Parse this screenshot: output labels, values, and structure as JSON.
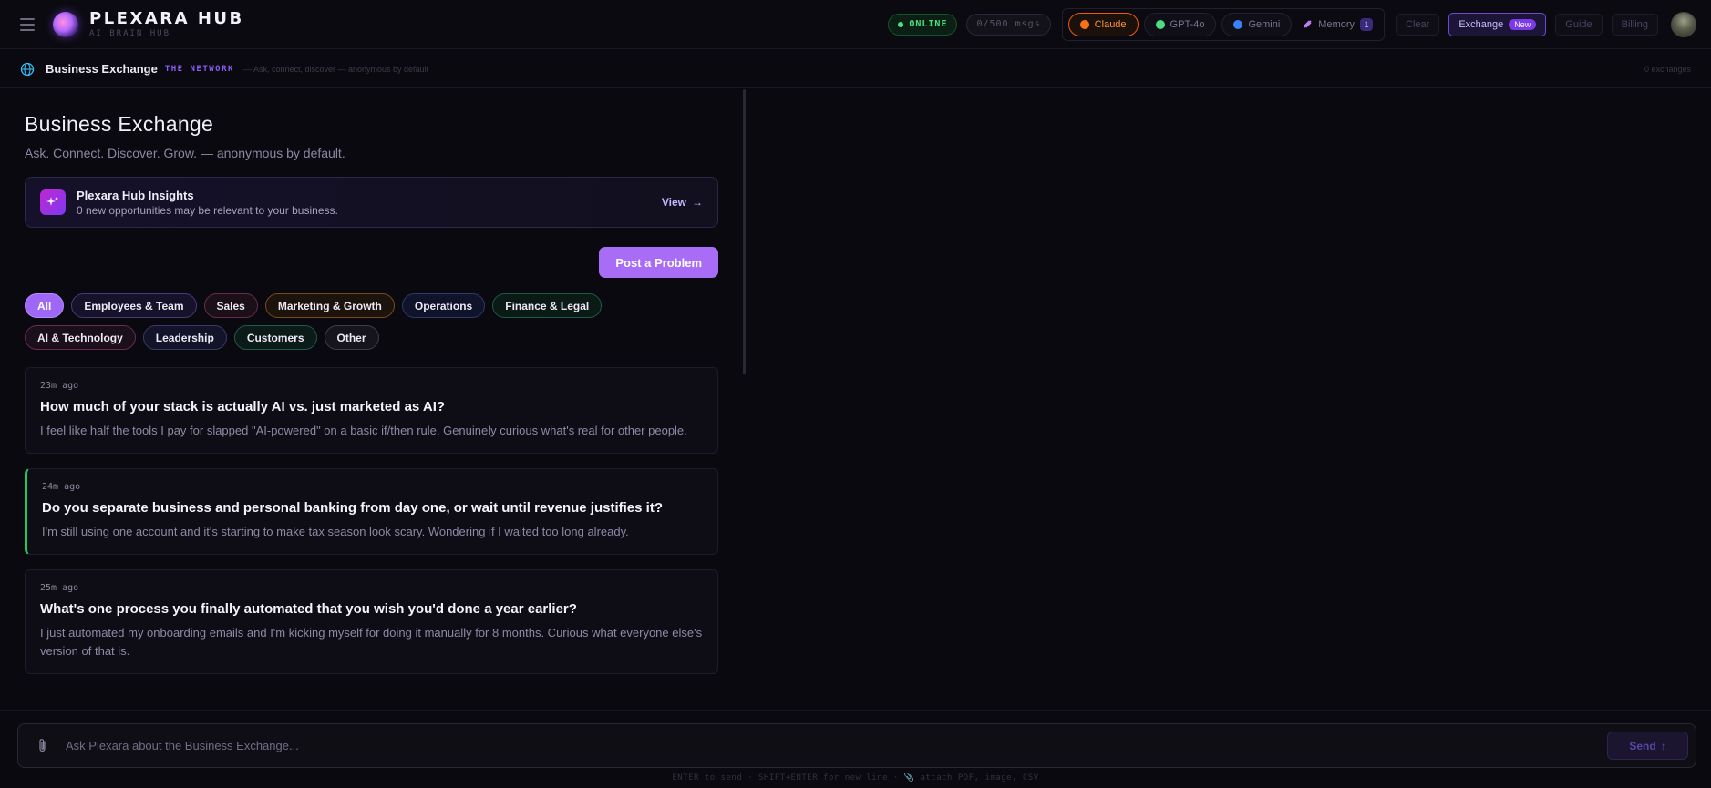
{
  "header": {
    "brand_name": "PLEXARA HUB",
    "brand_sub": "AI BRAIN HUB",
    "status": "ONLINE",
    "msgs": "0/500 msgs",
    "models": [
      {
        "label": "Claude",
        "color": "#f97316"
      },
      {
        "label": "GPT-4o",
        "color": "#4ade80"
      },
      {
        "label": "Gemini",
        "color": "#3b82f6"
      }
    ],
    "memory_label": "Memory",
    "memory_count": "1",
    "clear_label": "Clear",
    "exchange_label": "Exchange",
    "exchange_badge": "New",
    "guide_label": "Guide",
    "billing_label": "Billing"
  },
  "subheader": {
    "title": "Business Exchange",
    "network": "THE NETWORK",
    "tagline": "— Ask, connect, discover — anonymous by default",
    "count": "0 exchanges"
  },
  "main": {
    "title": "Business Exchange",
    "subtitle": "Ask. Connect. Discover. Grow. — anonymous by default.",
    "insights": {
      "title": "Plexara Hub Insights",
      "desc": "0 new opportunities may be relevant to your business.",
      "view": "View"
    },
    "post_button": "Post a Problem",
    "filters": [
      "All",
      "Employees & Team",
      "Sales",
      "Marketing & Growth",
      "Operations",
      "Finance & Legal",
      "AI & Technology",
      "Leadership",
      "Customers",
      "Other"
    ],
    "posts": [
      {
        "time": "23m ago",
        "title": "How much of your stack is actually AI vs. just marketed as AI?",
        "body": "I feel like half the tools I pay for slapped \"AI-powered\" on a basic if/then rule. Genuinely curious what's real for other people."
      },
      {
        "time": "24m ago",
        "title": "Do you separate business and personal banking from day one, or wait until revenue justifies it?",
        "body": "I'm still using one account and it's starting to make tax season look scary. Wondering if I waited too long already."
      },
      {
        "time": "25m ago",
        "title": "What's one process you finally automated that you wish you'd done a year earlier?",
        "body": "I just automated my onboarding emails and I'm kicking myself for doing it manually for 8 months. Curious what everyone else's version of that is."
      }
    ]
  },
  "composer": {
    "placeholder": "Ask Plexara about the Business Exchange...",
    "send_label": "Send",
    "hint": "ENTER to send · SHIFT+ENTER for new line · 📎 attach PDF, image, CSV"
  },
  "colors": {
    "accent": "#a86cf7",
    "online": "#4ade80",
    "claude": "#f97316",
    "highlight_border": "#22c55e"
  }
}
